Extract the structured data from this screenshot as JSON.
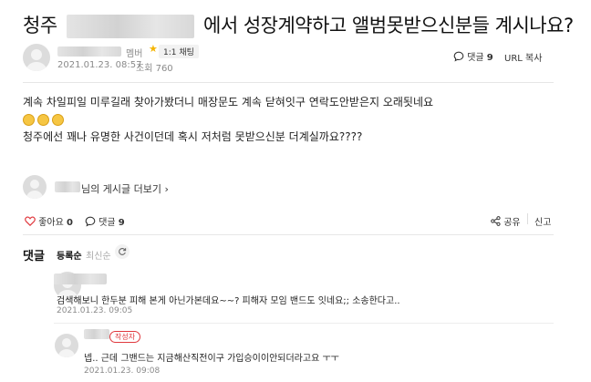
{
  "post": {
    "title_prefix": "청주",
    "title_suffix": "에서 성장계약하고 앨범못받으신분들 계시나요?",
    "author_suffix": "멤버",
    "star": "★",
    "chat_label": "1:1 채팅",
    "date": "2021.01.23. 08:57",
    "views": "조회 760",
    "comment_label": "댓글",
    "comment_count": "9",
    "url_copy": "URL 복사",
    "body_line1": "계속 차일피일 미루길래 찾아가봤더니 매장문도 계속 닫혀잇구 연락도안받은지 오래됫네요",
    "body_line3": "청주에선 꽤나 유명한 사건이던데  혹시 저처럼 못받으신분 더계실까요????",
    "more_posts": "님의 게시글 더보기",
    "more_chevron": "›"
  },
  "actions": {
    "like_label": "좋아요",
    "like_count": "0",
    "comment_label": "댓글",
    "comment_count": "9",
    "share_label": "공유",
    "report_label": "신고"
  },
  "comments": {
    "heading": "댓글",
    "sort_registered": "등록순",
    "sort_latest": "최신순",
    "items": [
      {
        "text": "검색해보니 한두분 피해 본게 아닌가본데요~~? 피해자 모임 밴드도 잇네요;; 소송한다고..",
        "date": "2021.01.23. 09:05"
      },
      {
        "badge": "작성자",
        "text": "넵.. 근데 그밴드는 지금해산직전이구 가입승이이안되더라고요 ㅜㅜ",
        "date": "2021.01.23. 09:08"
      }
    ]
  },
  "icons": {
    "like": "heart-outline-icon",
    "comment": "speech-bubble-icon",
    "share": "share-icon",
    "refresh": "refresh-icon"
  },
  "colors": {
    "accent_red": "#e0393e",
    "star": "#f5b400",
    "muted": "#8a8a8a"
  }
}
